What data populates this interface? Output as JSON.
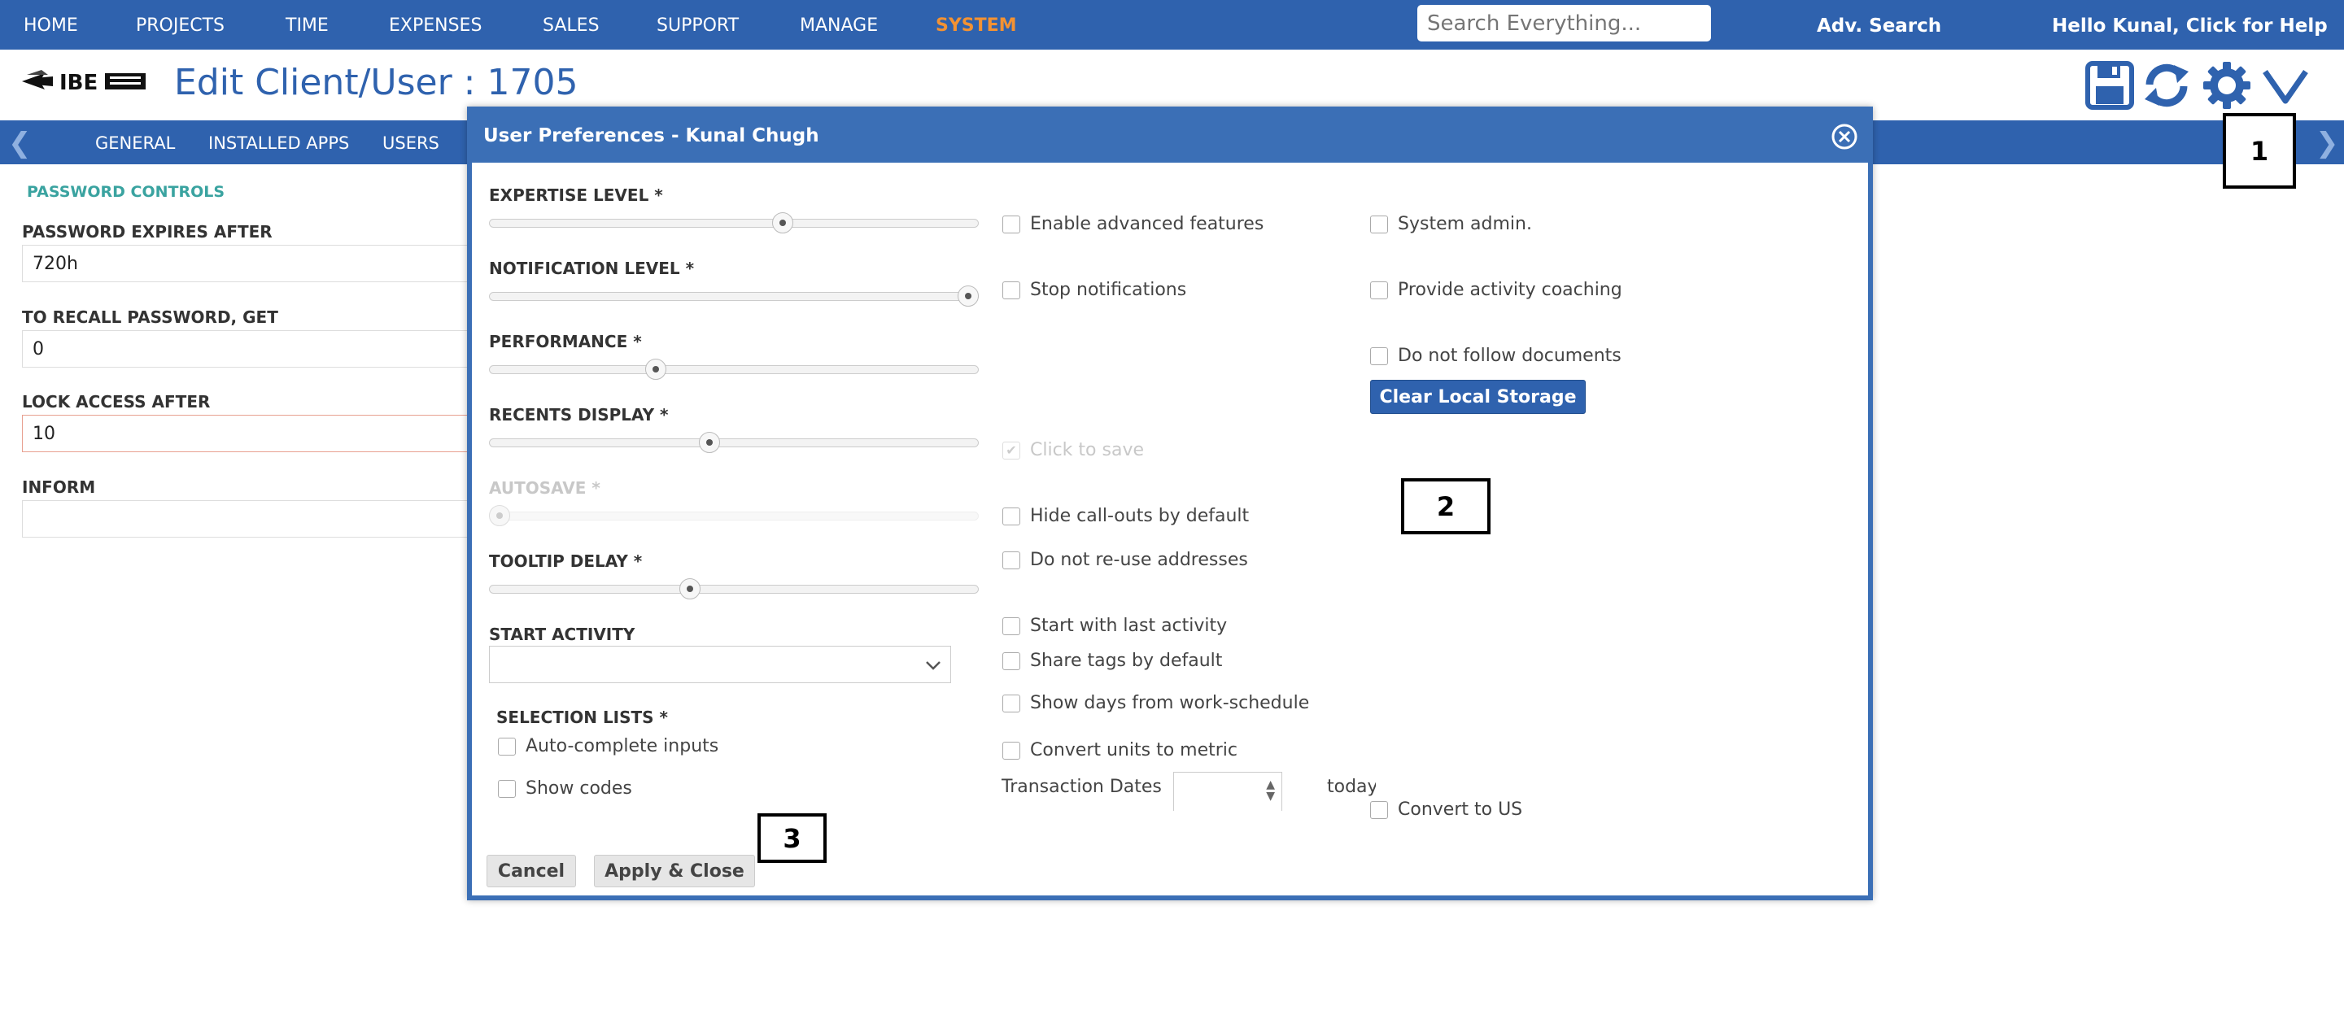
{
  "topnav": {
    "items": [
      "HOME",
      "PROJECTS",
      "TIME",
      "EXPENSES",
      "SALES",
      "SUPPORT",
      "MANAGE",
      "SYSTEM"
    ],
    "active": "SYSTEM",
    "search_placeholder": "Search Everything...",
    "adv_search": "Adv. Search",
    "greeting": "Hello Kunal, Click for Help"
  },
  "header": {
    "logo_text": "IBE",
    "title": "Edit Client/User : 1705"
  },
  "tabs": [
    "GENERAL",
    "INSTALLED APPS",
    "USERS"
  ],
  "form": {
    "section": "PASSWORD CONTROLS",
    "fields": [
      {
        "label": "PASSWORD EXPIRES AFTER",
        "value": "720h"
      },
      {
        "label": "TO RECALL PASSWORD, GET",
        "value": "0"
      },
      {
        "label": "LOCK ACCESS AFTER",
        "value": "10"
      },
      {
        "label": "INFORM",
        "value": ""
      }
    ]
  },
  "callouts": [
    "1",
    "2",
    "3"
  ],
  "dialog": {
    "title": "User Preferences - Kunal Chugh",
    "sliders": [
      {
        "label": "EXPERTISE LEVEL *",
        "level": 0.6
      },
      {
        "label": "NOTIFICATION LEVEL *",
        "level": 0.98
      },
      {
        "label": "PERFORMANCE *",
        "level": 0.34
      },
      {
        "label": "RECENTS DISPLAY *",
        "level": 0.45
      },
      {
        "label": "AUTOSAVE *",
        "level": 0.02
      },
      {
        "label": "TOOLTIP DELAY *",
        "level": 0.41
      }
    ],
    "start_activity_label": "START ACTIVITY",
    "start_activity_value": "",
    "selection_lists_label": "SELECTION LISTS *",
    "auto_complete": "Auto-complete inputs",
    "show_codes": "Show codes",
    "middle_checks": {
      "advanced": "Enable advanced features",
      "stop_notifications": "Stop notifications",
      "click_to_save": "Click to save",
      "hide_callouts": "Hide call-outs by default",
      "no_reuse": "Do not re-use addresses",
      "start_last": "Start with last activity",
      "share_tags": "Share tags by default",
      "show_days": "Show days from work-schedule",
      "metric": "Convert units to metric"
    },
    "right_checks": {
      "sysadmin": "System admin.",
      "coaching": "Provide activity coaching",
      "no_follow": "Do not follow documents",
      "to_us": "Convert to US"
    },
    "clear_storage": "Clear Local Storage",
    "transaction_dates": "Transaction Dates",
    "today": "today",
    "cancel": "Cancel",
    "apply": "Apply & Close"
  }
}
